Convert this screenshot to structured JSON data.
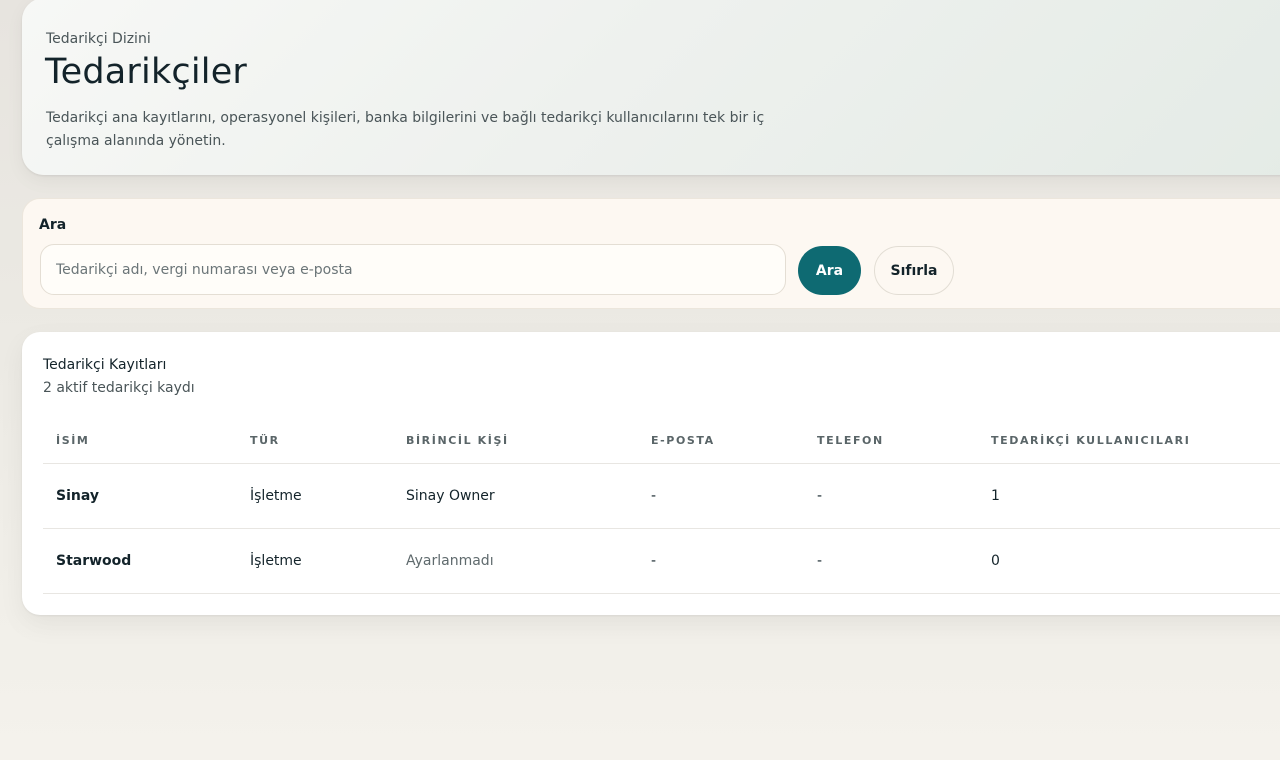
{
  "header": {
    "eyebrow": "Tedarikçi Dizini",
    "title": "Tedarikçiler",
    "description": "Tedarikçi ana kayıtlarını, operasyonel kişileri, banka bilgilerini ve bağlı tedarikçi kullanıcılarını tek bir iç çalışma alanında yönetin."
  },
  "search": {
    "label": "Ara",
    "value": "",
    "placeholder": "Tedarikçi adı, vergi numarası veya e-posta",
    "search_button": "Ara",
    "reset_button": "Sıfırla"
  },
  "records": {
    "title": "Tedarikçi Kayıtları",
    "subtitle": "2 aktif tedarikçi kaydı",
    "columns": [
      "İSİM",
      "TÜR",
      "BİRİNCİL KİŞİ",
      "E-POSTA",
      "TELEFON",
      "TEDARİKÇİ KULLANICILARI"
    ],
    "rows": [
      {
        "name": "Sinay",
        "type": "İşletme",
        "primary_contact": "Sinay Owner",
        "email": "-",
        "phone": "-",
        "supplier_users": "1"
      },
      {
        "name": "Starwood",
        "type": "İşletme",
        "primary_contact": "Ayarlanmadı",
        "email": "-",
        "phone": "-",
        "supplier_users": "0"
      }
    ]
  },
  "colors": {
    "primary_button": "#0e6a72",
    "search_card_bg": "#fdf8f2",
    "page_bg": "#ebe9e3"
  }
}
